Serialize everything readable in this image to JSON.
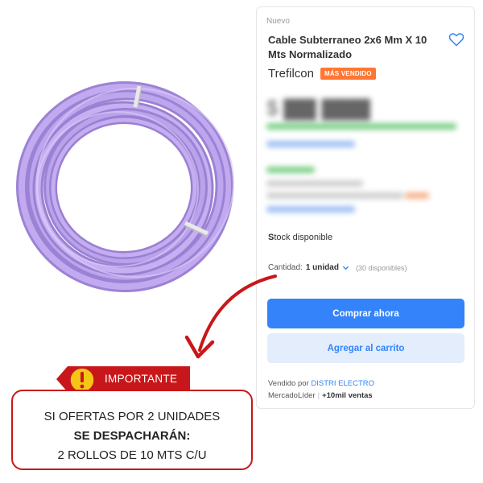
{
  "product": {
    "condition": "Nuevo",
    "title": "Cable Subterraneo 2x6 Mm X 10 Mts Normalizado",
    "brand": "Trefilcon",
    "badge": "MÁS VENDIDO",
    "stock_prefix": "S",
    "stock_rest": "tock disponible",
    "quantity_label": "Cantidad:",
    "quantity_value": "1 unidad",
    "available": "(30 disponibles)",
    "buy_now": "Comprar ahora",
    "add_to_cart": "Agregar al carrito",
    "sold_by_label": "Vendido por",
    "seller": "DISTRI ELECTRO",
    "seller_level": "MercadoLíder",
    "sales": "+10mil ventas"
  },
  "notice": {
    "tag": "IMPORTANTE",
    "line1": "SI OFERTAS POR 2 UNIDADES",
    "line2": "SE DESPACHARÁN:",
    "line3": "2 ROLLOS DE 10 MTS C/U"
  },
  "colors": {
    "accent_blue": "#3483fa",
    "badge_orange": "#ff7733",
    "notice_red": "#c8171a",
    "cable_lilac": "#b49ae6"
  },
  "icons": {
    "favorite": "heart-icon",
    "quantity_dropdown": "chevron-down-icon",
    "warning": "warning-icon",
    "pointer": "arrow-icon"
  }
}
